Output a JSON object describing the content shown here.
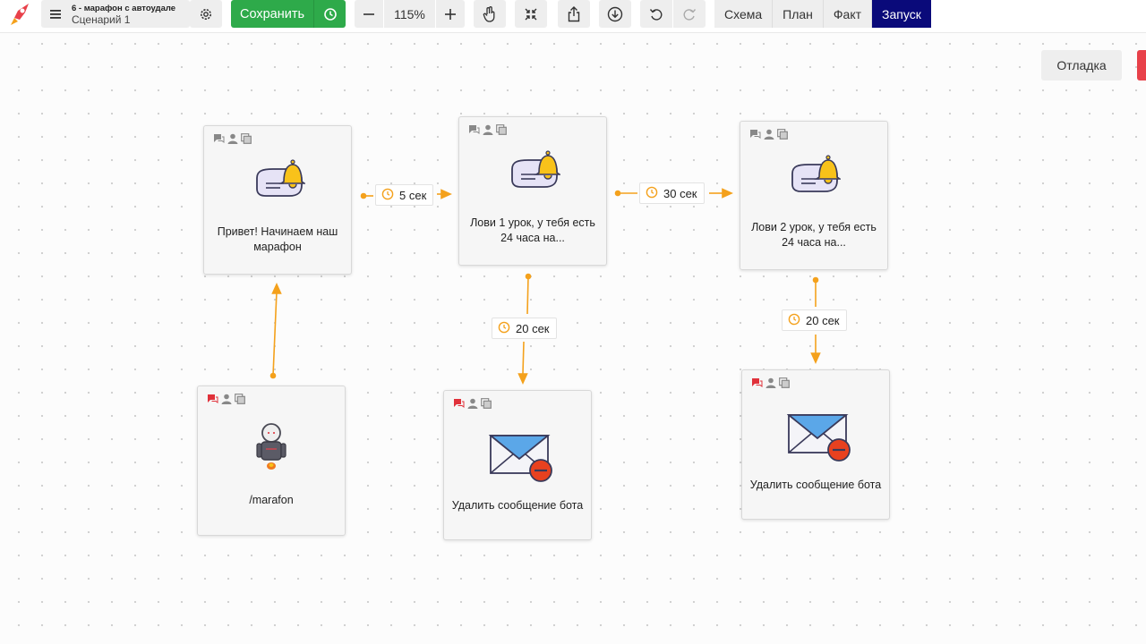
{
  "project": {
    "name": "6 - марафон с автоудале",
    "scenario": "Сценарий 1"
  },
  "toolbar": {
    "save_label": "Сохранить",
    "zoom": "115%",
    "tabs": [
      "Схема",
      "План",
      "Факт",
      "Запуск"
    ],
    "active_tab": "Запуск",
    "accent_green": "#2eaa4a",
    "accent_active": "#0a0a7a"
  },
  "debug_label": "Отладка",
  "nodes": [
    {
      "id": "greeting",
      "text": "Привет! Начинаем наш марафон",
      "icon": "message-bell-icon"
    },
    {
      "id": "lesson1",
      "text": "Лови 1 урок, у тебя есть 24 часа на...",
      "icon": "message-bell-icon"
    },
    {
      "id": "lesson2",
      "text": "Лови 2 урок, у тебя есть 24 часа на...",
      "icon": "message-bell-icon"
    },
    {
      "id": "start",
      "text": "/marafon",
      "icon": "robot-icon"
    },
    {
      "id": "delete1",
      "text": "Удалить сообщение бота",
      "icon": "envelope-delete-icon"
    },
    {
      "id": "delete2",
      "text": "Удалить сообщение бота",
      "icon": "envelope-delete-icon"
    }
  ],
  "delays": {
    "d1": "5 сек",
    "d2": "30 сек",
    "d3": "20 сек",
    "d4": "20 сек"
  },
  "connector_color": "#f4a11c"
}
